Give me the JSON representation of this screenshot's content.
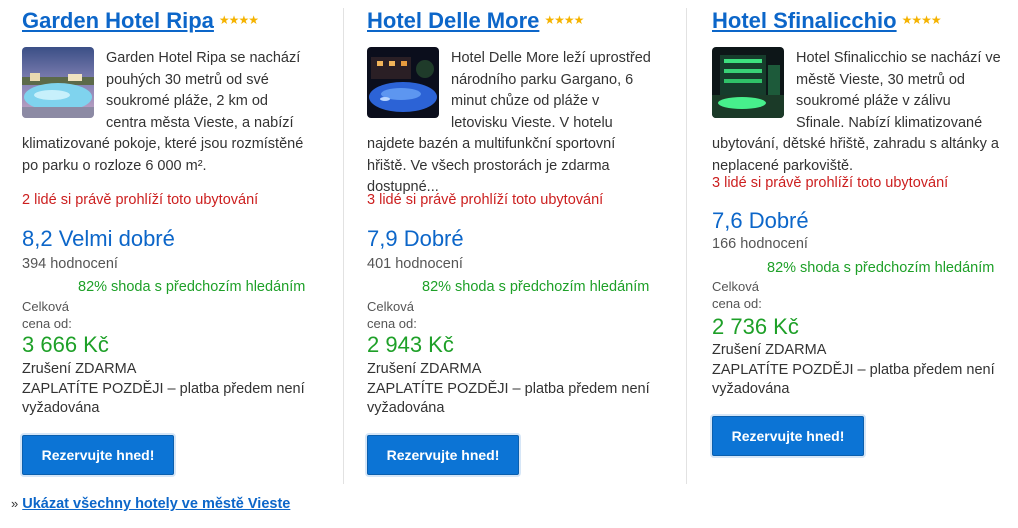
{
  "hotels": [
    {
      "name": "Garden Hotel Ripa",
      "stars": "★★★★",
      "thumb_icon": "hotel-pool-photo",
      "description": "Garden Hotel Ripa se nachází pouhých 30 metrů od své soukromé pláže, 2 km od centra města Vieste, a nabízí klimatizované pokoje, které jsou rozmístěné po parku o rozloze 6 000 m².",
      "viewers": "2 lidé si právě prohlíží toto ubytování",
      "score": "8,2 Velmi dobré",
      "reviews": "394 hodnocení",
      "match": "82% shoda s předchozím hledáním",
      "price_label_1": "Celková",
      "price_label_2": "cena od:",
      "price": "3 666 Kč",
      "cancel": "Zrušení ZDARMA",
      "pay_later": "ZAPLATÍTE POZDĚJI – platba předem není vyžadována",
      "button": "Rezervujte hned!"
    },
    {
      "name": "Hotel Delle More",
      "stars": "★★★★",
      "thumb_icon": "hotel-pool-night-photo",
      "description": "Hotel Delle More leží uprostřed národního parku Gargano, 6 minut chůze od pláže v letovisku Vieste. V hotelu najdete bazén a multifunkční sportovní hřiště. Ve všech prostorách je zdarma dostupné...",
      "viewers": "3 lidé si právě prohlíží toto ubytování",
      "score": "7,9 Dobré",
      "reviews": "401 hodnocení",
      "match": "82% shoda s předchozím hledáním",
      "price_label_1": "Celková",
      "price_label_2": "cena od:",
      "price": "2 943 Kč",
      "cancel": "Zrušení ZDARMA",
      "pay_later": "ZAPLATÍTE POZDĚJI – platba předem není vyžadována",
      "button": "Rezervujte hned!"
    },
    {
      "name": "Hotel Sfinalicchio",
      "stars": "★★★★",
      "thumb_icon": "hotel-building-night-photo",
      "description": "Hotel Sfinalicchio se nachází ve městě Vieste, 30 metrů od soukromé pláže v zálivu Sfinale. Nabízí klimatizované ubytování, dětské hřiště, zahradu s altánky a neplacené parkoviště.",
      "viewers": "3 lidé si právě prohlíží toto ubytování",
      "score": "7,6 Dobré",
      "reviews": "166 hodnocení",
      "match": "82% shoda s předchozím hledáním",
      "price_label_1": "Celková",
      "price_label_2": "cena od:",
      "price": "2 736 Kč",
      "cancel": "Zrušení ZDARMA",
      "pay_later": "ZAPLATÍTE POZDĚJI – platba předem není vyžadována",
      "button": "Rezervujte hned!"
    }
  ],
  "footer": {
    "marker": "»",
    "link": "Ukázat všechny hotely ve městě Vieste"
  },
  "colors": {
    "link_blue": "#0c66c9",
    "button_blue": "#0c74d5",
    "green": "#1ea028",
    "red": "#cc1f1f",
    "star": "#f5b301"
  }
}
